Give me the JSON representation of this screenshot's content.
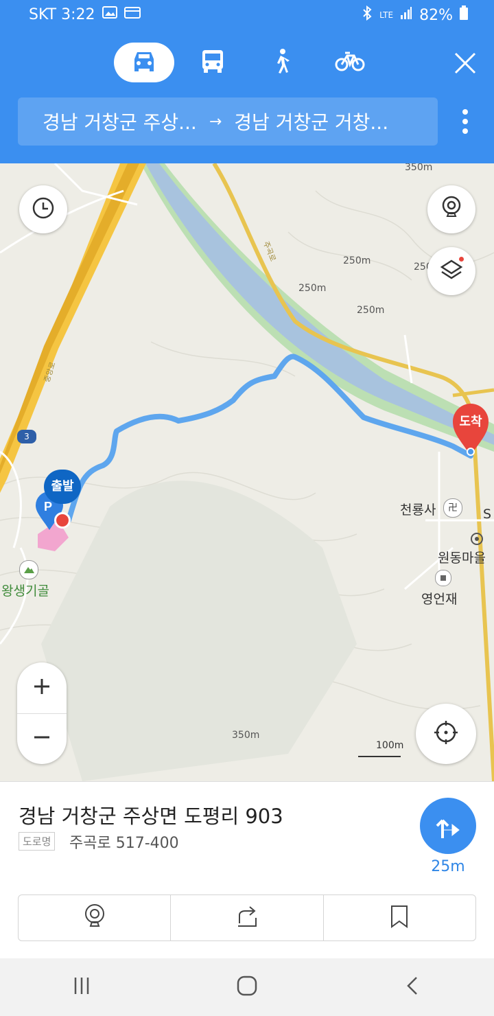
{
  "status": {
    "carrier_time": "SKT 3:22",
    "lte": "LTE",
    "battery": "82%"
  },
  "modes": [
    {
      "name": "car",
      "active": true
    },
    {
      "name": "bus",
      "active": false
    },
    {
      "name": "walk",
      "active": false
    },
    {
      "name": "bike",
      "active": false
    }
  ],
  "route": {
    "from": "경남 거창군 주상...",
    "arrow": "→",
    "to": "경남 거창군 거창..."
  },
  "map": {
    "elevations": [
      "350m",
      "250m",
      "250m",
      "250m",
      "250",
      "350m"
    ],
    "road_names": [
      "주곡로",
      "중앙로"
    ],
    "highway_number": "3",
    "start_label": "출발",
    "end_label": "도착",
    "pois": {
      "temple": "천룡사",
      "village": "원동마을",
      "place": "영언재",
      "valley": "왕생기골",
      "s_label": "S"
    },
    "scale": "100m"
  },
  "colors": {
    "header": "#3b8ff0",
    "route": "#5ea6ee",
    "start": "#0f66c4",
    "end": "#e8453c"
  },
  "panel": {
    "address": "경남 거창군 주상면 도평리 903",
    "road_tag": "도로명",
    "road_address": "주곡로 517-400",
    "turn_distance": "25m"
  }
}
